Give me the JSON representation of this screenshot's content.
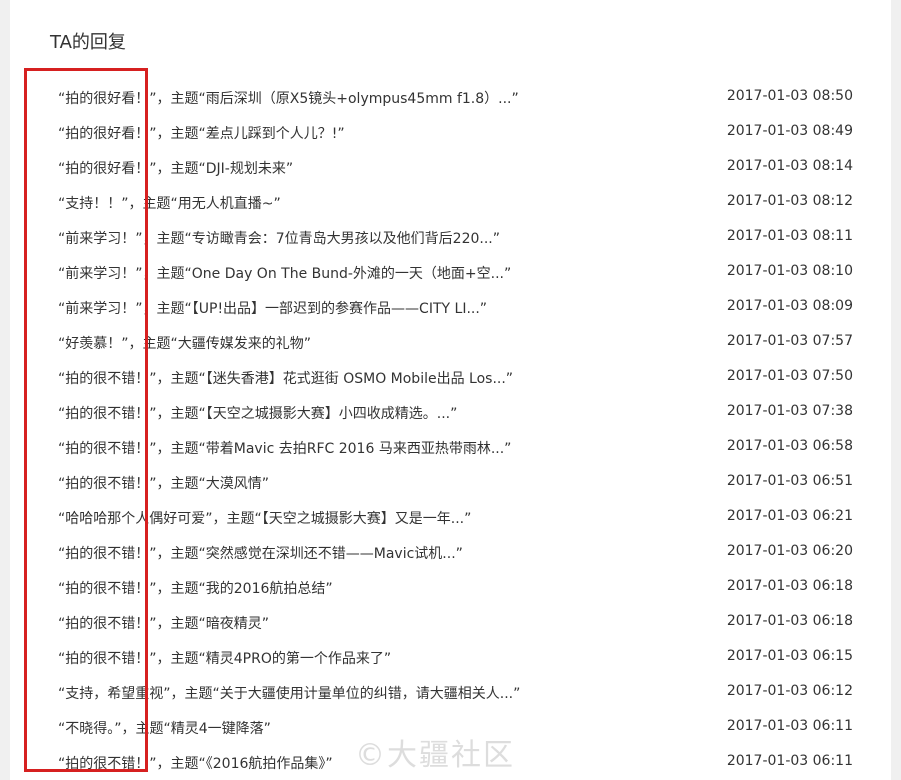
{
  "section_title": "TA的回复",
  "watermark": "©大疆社区",
  "colors": {
    "highlight_border": "#d62020",
    "text": "#333333"
  },
  "replies": [
    {
      "text": "“拍的很好看！”，主题“雨后深圳（原X5镜头+olympus45mm f1.8）...”",
      "time": "2017-01-03 08:50"
    },
    {
      "text": "“拍的很好看！”，主题“差点儿踩到个人儿？!”",
      "time": "2017-01-03 08:49"
    },
    {
      "text": "“拍的很好看！”，主题“DJI-规划未来”",
      "time": "2017-01-03 08:14"
    },
    {
      "text": "“支持！！”，主题“用无人机直播~”",
      "time": "2017-01-03 08:12"
    },
    {
      "text": "“前来学习！”，主题“专访瞰青会：7位青岛大男孩以及他们背后220...”",
      "time": "2017-01-03 08:11"
    },
    {
      "text": "“前来学习！”，主题“One Day On The Bund-外滩的一天（地面+空...”",
      "time": "2017-01-03 08:10"
    },
    {
      "text": "“前来学习！”，主题“【UP!出品】一部迟到的参赛作品——CITY LI...”",
      "time": "2017-01-03 08:09"
    },
    {
      "text": "“好羡慕！”，主题“大疆传媒发来的礼物”",
      "time": "2017-01-03 07:57"
    },
    {
      "text": "“拍的很不错！”，主题“【迷失香港】花式逛街 OSMO Mobile出品 Los...”",
      "time": "2017-01-03 07:50"
    },
    {
      "text": "“拍的很不错！”，主题“【天空之城摄影大赛】小四收成精选。...”",
      "time": "2017-01-03 07:38"
    },
    {
      "text": "“拍的很不错！”，主题“带着Mavic 去拍RFC 2016 马来西亚热带雨林...”",
      "time": "2017-01-03 06:58"
    },
    {
      "text": "“拍的很不错！”，主题“大漠风情”",
      "time": "2017-01-03 06:51"
    },
    {
      "text": "“哈哈哈那个人偶好可爱”，主题“【天空之城摄影大赛】又是一年...”",
      "time": "2017-01-03 06:21"
    },
    {
      "text": "“拍的很不错！”，主题“突然感觉在深圳还不错——Mavic试机...”",
      "time": "2017-01-03 06:20"
    },
    {
      "text": "“拍的很不错！”，主题“我的2016航拍总结”",
      "time": "2017-01-03 06:18"
    },
    {
      "text": "“拍的很不错！”，主题“暗夜精灵”",
      "time": "2017-01-03 06:18"
    },
    {
      "text": "“拍的很不错！”，主题“精灵4PRO的第一个作品来了”",
      "time": "2017-01-03 06:15"
    },
    {
      "text": "“支持，希望重视”，主题“关于大疆使用计量单位的纠错，请大疆相关人...”",
      "time": "2017-01-03 06:12"
    },
    {
      "text": "“不晓得。”，主题“精灵4一键降落”",
      "time": "2017-01-03 06:11"
    },
    {
      "text": "“拍的很不错！”，主题“《2016航拍作品集》”",
      "time": "2017-01-03 06:11"
    }
  ]
}
